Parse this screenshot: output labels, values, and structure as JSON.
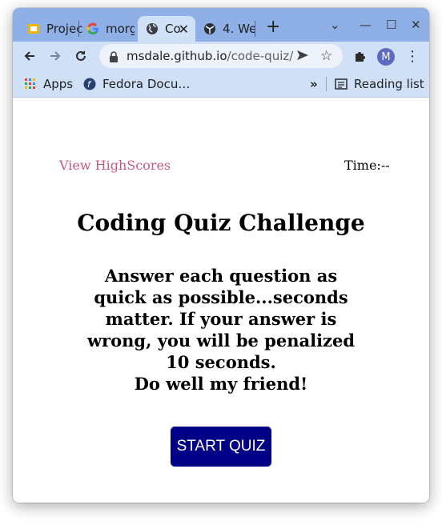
{
  "browser": {
    "tabs": [
      {
        "title": "Projec",
        "icon": "slides-icon",
        "active": false
      },
      {
        "title": "morga",
        "icon": "google-icon",
        "active": false
      },
      {
        "title": "Co",
        "icon": "globe-icon",
        "active": true
      },
      {
        "title": "4. We",
        "icon": "webpack-icon",
        "active": false
      }
    ],
    "new_tab_label": "+",
    "url_host": "msdale.github.io",
    "url_path": "/code-quiz/",
    "profile_initial": "M",
    "bookmarks": [
      {
        "label": "Apps",
        "icon": "apps-grid-icon"
      },
      {
        "label": "Fedora Docu…",
        "icon": "fedora-icon"
      }
    ],
    "reading_list_label": "Reading list",
    "overflow_label": "»"
  },
  "page": {
    "highscores_link": "View HighScores",
    "timer_label": "Time:",
    "timer_value": "--",
    "title": "Coding Quiz Challenge",
    "instructions": "Answer each question as quick as possible...seconds matter. If your answer is wrong, you will be penalized 10 seconds.",
    "farewell": "Do well my friend!",
    "start_button": "START QUIZ"
  },
  "colors": {
    "tabstrip": "#8fb0e6",
    "toolbar": "#cfe0f7",
    "link": "#c85a7f",
    "start_button_bg": "#000087"
  }
}
